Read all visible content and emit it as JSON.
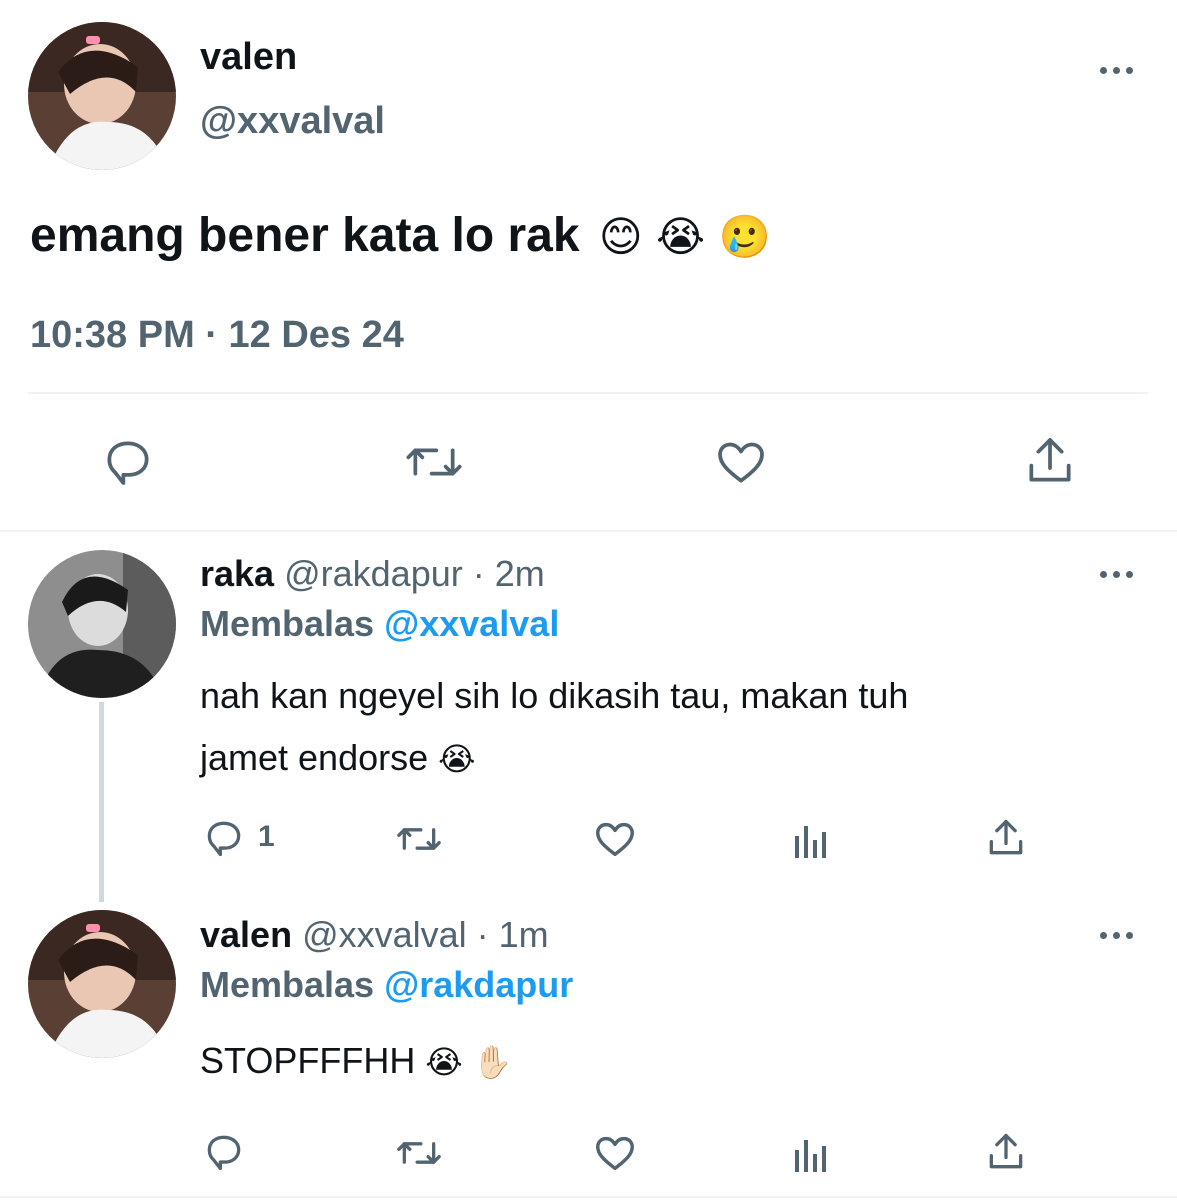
{
  "main_tweet": {
    "display_name": "valen",
    "handle": "@xxvalval",
    "text": "emang bener kata lo rak",
    "emojis": [
      "😊",
      "😭",
      "🥲"
    ],
    "timestamp": "10:38 PM · 12 Des 24"
  },
  "replies": [
    {
      "display_name": "raka",
      "handle_time": "@rakdapur · 2m",
      "replying_label": "Membalas",
      "replying_to": "@xxvalval",
      "text_line1": "nah kan ngeyel sih lo dikasih tau, makan tuh",
      "text_line2": "jamet endorse",
      "emoji": "😭",
      "reply_count": "1"
    },
    {
      "display_name": "valen",
      "handle_time": "@xxvalval · 1m",
      "replying_label": "Membalas",
      "replying_to": "@rakdapur",
      "text": "STOPFFFHH",
      "emojis": [
        "😭",
        "✋🏻"
      ]
    }
  ],
  "icons": [
    "reply-icon",
    "retweet-icon",
    "like-icon",
    "share-icon",
    "views-icon",
    "more-icon"
  ],
  "colors": {
    "accent": "#1d9bf0",
    "muted": "#536471",
    "text": "#0f1419",
    "divider": "#eff3f4"
  }
}
